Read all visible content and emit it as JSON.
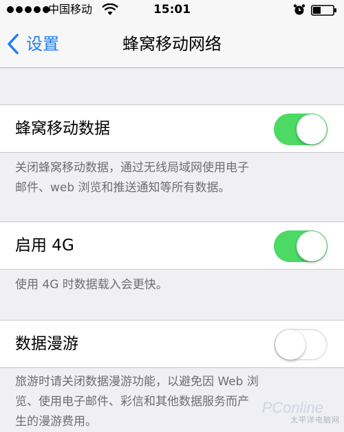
{
  "status_bar": {
    "carrier": "中国移动",
    "time": "15:01",
    "signal_bars": 5,
    "icons": [
      "signal-icon",
      "wifi-icon",
      "alarm-icon",
      "battery-icon"
    ]
  },
  "nav": {
    "back_label": "设置",
    "title": "蜂窝移动网络",
    "accent_color": "#1c7cf4"
  },
  "settings": [
    {
      "label": "蜂窝移动数据",
      "enabled": true,
      "footer": [
        "关闭蜂窝移动数据，通过无线局域网使用电子",
        "邮件、web 浏览和推送通知等所有数据。"
      ]
    },
    {
      "label": "启用 4G",
      "enabled": true,
      "footer": [
        "使用 4G 时数据载入会更快。"
      ]
    },
    {
      "label": "数据漫游",
      "enabled": false,
      "footer": [
        "旅游时请关闭数据漫游功能，以避免因 Web 浏",
        "览、使用电子邮件、彩信和其他数据服务而产",
        "生的漫游费用。"
      ]
    }
  ],
  "colors": {
    "toggle_on": "#4cd964",
    "background": "#efeff4",
    "footer_text": "#6d6d72"
  },
  "watermark": {
    "text": "太平洋电脑网",
    "logo": "PConline"
  }
}
